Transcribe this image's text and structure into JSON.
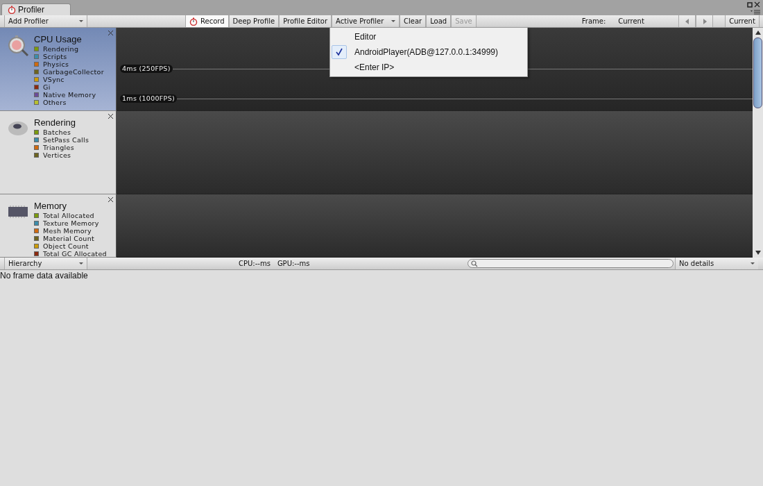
{
  "window": {
    "tab_title": "Profiler"
  },
  "toolbar": {
    "add_profiler": "Add Profiler",
    "items": [
      {
        "label": "Record",
        "kind": "record",
        "disabled": false
      },
      {
        "label": "Deep Profile",
        "kind": "button",
        "disabled": false
      },
      {
        "label": "Profile Editor",
        "kind": "button",
        "disabled": false
      },
      {
        "label": "Active Profiler",
        "kind": "dropdown",
        "disabled": false
      },
      {
        "label": "Clear",
        "kind": "button",
        "disabled": false
      },
      {
        "label": "Load",
        "kind": "button",
        "disabled": false
      },
      {
        "label": "Save",
        "kind": "button",
        "disabled": true
      }
    ],
    "frame_label": "Frame:",
    "frame_value": "Current",
    "current_button": "Current"
  },
  "profilers": [
    {
      "title": "CPU Usage",
      "kind": "cpu",
      "selected": true,
      "thresholds": [
        "4ms (250FPS)",
        "1ms (1000FPS)"
      ],
      "legend": [
        {
          "label": "Rendering",
          "color": "#7a9a0e"
        },
        {
          "label": "Scripts",
          "color": "#3c8dab"
        },
        {
          "label": "Physics",
          "color": "#d06a10"
        },
        {
          "label": "GarbageCollector",
          "color": "#6d6420"
        },
        {
          "label": "VSync",
          "color": "#cc9c0a"
        },
        {
          "label": "Gi",
          "color": "#8c2a10"
        },
        {
          "label": "Native Memory",
          "color": "#6b4c9a"
        },
        {
          "label": "Others",
          "color": "#b8c030"
        }
      ]
    },
    {
      "title": "Rendering",
      "kind": "rendering",
      "selected": false,
      "legend": [
        {
          "label": "Batches",
          "color": "#7a9a0e"
        },
        {
          "label": "SetPass Calls",
          "color": "#3c8dab"
        },
        {
          "label": "Triangles",
          "color": "#d06a10"
        },
        {
          "label": "Vertices",
          "color": "#6d6420"
        }
      ]
    },
    {
      "title": "Memory",
      "kind": "memory",
      "selected": false,
      "legend": [
        {
          "label": "Total Allocated",
          "color": "#7a9a0e"
        },
        {
          "label": "Texture Memory",
          "color": "#3c8dab"
        },
        {
          "label": "Mesh Memory",
          "color": "#d06a10"
        },
        {
          "label": "Material Count",
          "color": "#6d6420"
        },
        {
          "label": "Object Count",
          "color": "#cc9c0a"
        },
        {
          "label": "Total GC Allocated",
          "color": "#8c2a10"
        }
      ]
    }
  ],
  "menu": {
    "items": [
      {
        "label": "Editor",
        "checked": false
      },
      {
        "label": "AndroidPlayer(ADB@127.0.0.1:34999)",
        "checked": true
      },
      {
        "label": "<Enter IP>",
        "checked": false
      }
    ]
  },
  "details": {
    "view": "Hierarchy",
    "cpu": "CPU:--ms",
    "gpu": "GPU:--ms",
    "details_view": "No details",
    "message": "No frame data available"
  }
}
